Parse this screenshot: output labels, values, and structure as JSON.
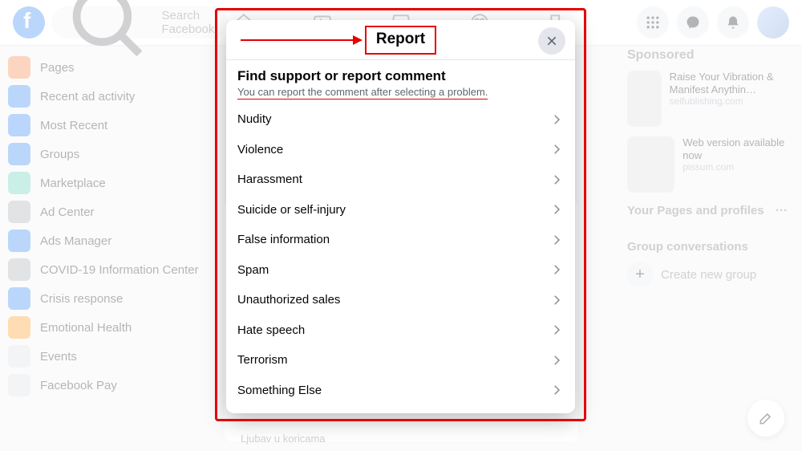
{
  "topbar": {
    "search_placeholder": "Search Facebook"
  },
  "left_nav": {
    "items": [
      {
        "label": "Pages"
      },
      {
        "label": "Recent ad activity"
      },
      {
        "label": "Most Recent"
      },
      {
        "label": "Groups"
      },
      {
        "label": "Marketplace"
      },
      {
        "label": "Ad Center"
      },
      {
        "label": "Ads Manager"
      },
      {
        "label": "COVID-19 Information Center"
      },
      {
        "label": "Crisis response"
      },
      {
        "label": "Emotional Health"
      },
      {
        "label": "Events"
      },
      {
        "label": "Facebook Pay"
      }
    ]
  },
  "right_col": {
    "sponsored_title": "Sponsored",
    "ads": [
      {
        "headline": "Raise Your Vibration & Manifest Anythin…",
        "domain": "selfublishing.com"
      },
      {
        "headline": "Web version available now",
        "domain": "pissum.com"
      }
    ],
    "pages_header": "Your Pages and profiles",
    "pages_more": "···",
    "group_header": "Group conversations",
    "create_group": "Create new group"
  },
  "feed": {
    "caption": "Ljubav u koricama"
  },
  "modal": {
    "title": "Report",
    "heading": "Find support or report comment",
    "subtext": "You can report the comment after selecting a problem.",
    "options": [
      {
        "label": "Nudity"
      },
      {
        "label": "Violence"
      },
      {
        "label": "Harassment"
      },
      {
        "label": "Suicide or self-injury"
      },
      {
        "label": "False information"
      },
      {
        "label": "Spam"
      },
      {
        "label": "Unauthorized sales"
      },
      {
        "label": "Hate speech"
      },
      {
        "label": "Terrorism"
      },
      {
        "label": "Something Else"
      }
    ]
  }
}
